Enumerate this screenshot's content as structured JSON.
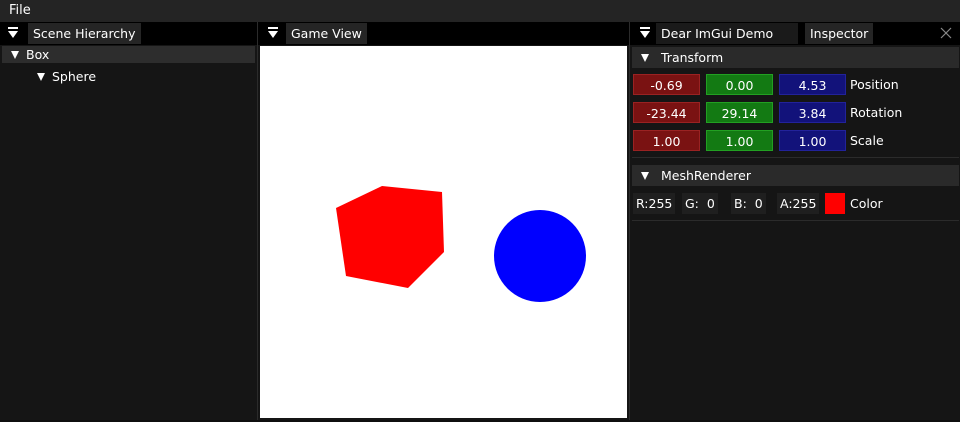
{
  "menubar": {
    "file": "File"
  },
  "hierarchy": {
    "tab": "Scene Hierarchy",
    "items": [
      {
        "label": "Box",
        "selected": true
      },
      {
        "label": "Sphere",
        "selected": false
      }
    ]
  },
  "gameview": {
    "tab": "Game View",
    "background": "#ffffff",
    "cube_color": "#ff0000",
    "sphere_color": "#0000ff"
  },
  "inspector": {
    "tabs": [
      "Dear ImGui Demo",
      "Inspector"
    ],
    "transform": {
      "header": "Transform",
      "rows": [
        {
          "label": "Position",
          "x": "-0.69",
          "y": "0.00",
          "z": "4.53"
        },
        {
          "label": "Rotation",
          "x": "-23.44",
          "y": "29.14",
          "z": "3.84"
        },
        {
          "label": "Scale",
          "x": "1.00",
          "y": "1.00",
          "z": "1.00"
        }
      ]
    },
    "meshrenderer": {
      "header": "MeshRenderer",
      "r": "R:255",
      "g": "G:  0",
      "b": "B:  0",
      "a": "A:255",
      "color_label": "Color",
      "swatch": "#ff0000"
    }
  }
}
